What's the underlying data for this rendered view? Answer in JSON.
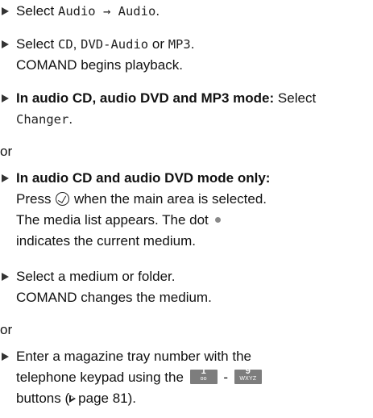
{
  "steps": [
    {
      "select_prefix": "Select",
      "menu_path": "Audio → Audio",
      "period": "."
    },
    {
      "select_prefix": "Select",
      "cd": "CD",
      "comma": ",",
      "dvd_audio": "DVD-Audio",
      "or_word": "or",
      "mp3": "MP3",
      "period": ".",
      "result": "COMAND begins playback."
    },
    {
      "bold_condition": "In audio CD, audio DVD and MP3 mode:",
      "select_prefix": "Select",
      "changer": "Changer",
      "period": "."
    },
    {
      "bold_condition": "In audio CD and audio DVD mode only:",
      "press": "Press",
      "after_knob": "when the main area is selected.",
      "line2": "The media list appears. The dot",
      "line3": "indicates the current medium."
    },
    {
      "line1": "Select a medium or folder.",
      "result": "COMAND changes the medium."
    },
    {
      "line1": "Enter a magazine tray number with the",
      "line2_prefix": "telephone keypad using the",
      "dash": "-",
      "line3_suffix": "buttons (",
      "page_ref": "page 81).",
      "key_first": {
        "number": "1",
        "letters": "oo"
      },
      "key_last": {
        "number": "9",
        "letters": "WXYZ"
      }
    }
  ],
  "separators": {
    "or_1": "or",
    "or_2": "or"
  },
  "icons": {
    "bullet": "right-triangle-bullet-icon",
    "knob": "controller-press-icon",
    "dot": "current-medium-dot-icon",
    "page_ref": "page-reference-triangle-icon"
  },
  "colors": {
    "text": "#111111",
    "keycap_bg": "#7d7d7d",
    "dot": "#8a8a8a"
  }
}
